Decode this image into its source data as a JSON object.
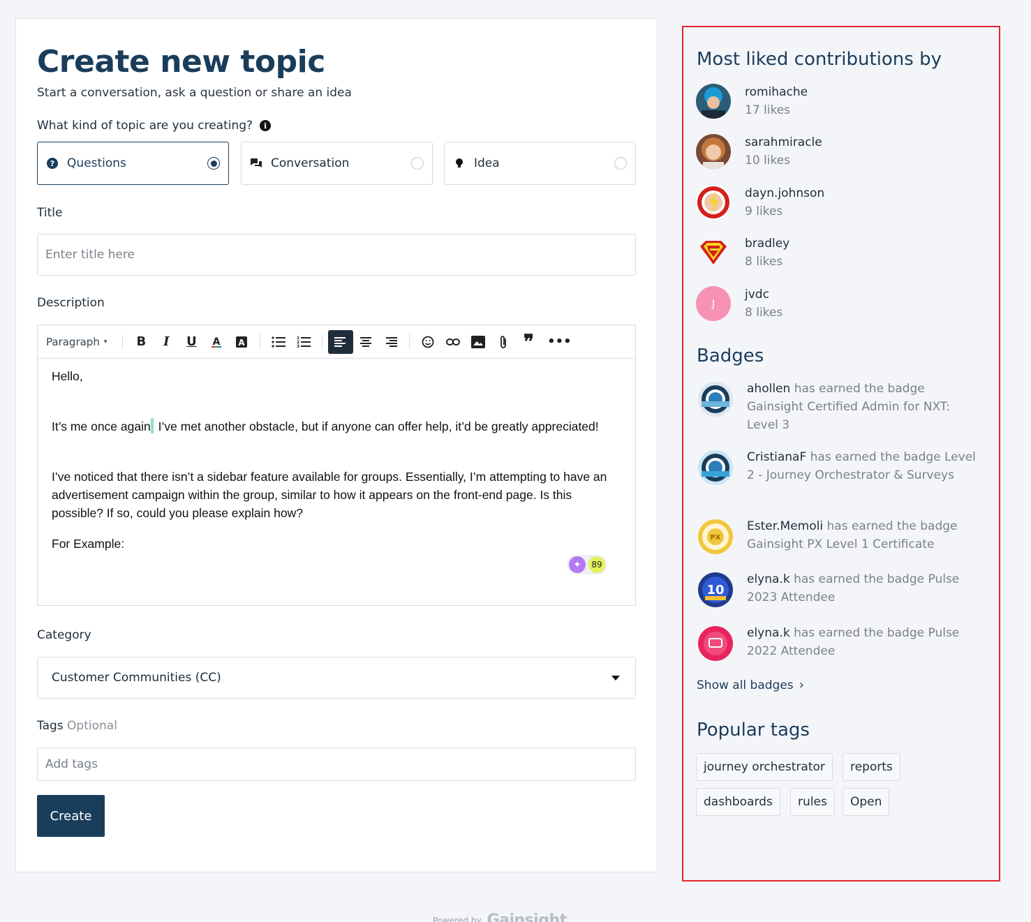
{
  "form": {
    "title": "Create new topic",
    "subtitle": "Start a conversation, ask a question or share an idea",
    "kind_label": "What kind of topic are you creating?",
    "kinds": [
      {
        "label": "Questions",
        "icon": "question-circle-icon",
        "selected": true
      },
      {
        "label": "Conversation",
        "icon": "chat-bubbles-icon",
        "selected": false
      },
      {
        "label": "Idea",
        "icon": "lightbulb-icon",
        "selected": false
      }
    ],
    "title_label": "Title",
    "title_placeholder": "Enter title here",
    "description_label": "Description",
    "toolbar": {
      "paragraph": "Paragraph"
    },
    "editor": {
      "line1": "Hello,",
      "line2a": "It’s me once again",
      "line2b": "I’ve met another obstacle, but if anyone can offer help, it’d be greatly appreciated!",
      "line3": "I’ve noticed that there isn’t a sidebar feature available for groups. Essentially, I’m attempting to have an advertisement campaign within the group, similar to how it appears on the front-end page. Is this possible? If so, could you please explain how?",
      "line4": "For Example:",
      "counter": "89"
    },
    "category_label": "Category",
    "category_value": "Customer Communities (CC)",
    "tags_label": "Tags",
    "tags_optional": "Optional",
    "tags_placeholder": "Add tags",
    "create_label": "Create"
  },
  "sidebar": {
    "liked_title": "Most liked contributions by",
    "contributors": [
      {
        "name": "romihache",
        "likes": "17 likes"
      },
      {
        "name": "sarahmiracle",
        "likes": "10 likes"
      },
      {
        "name": "dayn.johnson",
        "likes": "9 likes"
      },
      {
        "name": "bradley",
        "likes": "8 likes"
      },
      {
        "name": "jvdc",
        "likes": "8 likes",
        "initial": "J"
      }
    ],
    "badges_title": "Badges",
    "badges": [
      {
        "user": "ahollen",
        "text": "has earned the badge Gainsight Certified Admin for NXT: Level 3"
      },
      {
        "user": "CristianaF",
        "text": "has earned the badge Level 2 - Journey Orchestrator & Surveys"
      },
      {
        "user": "Ester.Memoli",
        "text": "has earned the badge Gainsight PX Level 1 Certificate"
      },
      {
        "user": "elyna.k",
        "text": "has earned the badge Pulse 2023 Attendee"
      },
      {
        "user": "elyna.k",
        "text": "has earned the badge Pulse 2022 Attendee"
      }
    ],
    "show_all_badges": "Show all badges",
    "tags_title": "Popular tags",
    "tags": [
      "journey orchestrator",
      "reports",
      "dashboards",
      "rules",
      "Open"
    ]
  },
  "footer": {
    "powered_by": "Powered by",
    "brand": "Gainsight"
  },
  "colors": {
    "primary": "#1a3d5c",
    "highlight_border": "#e0262e"
  }
}
